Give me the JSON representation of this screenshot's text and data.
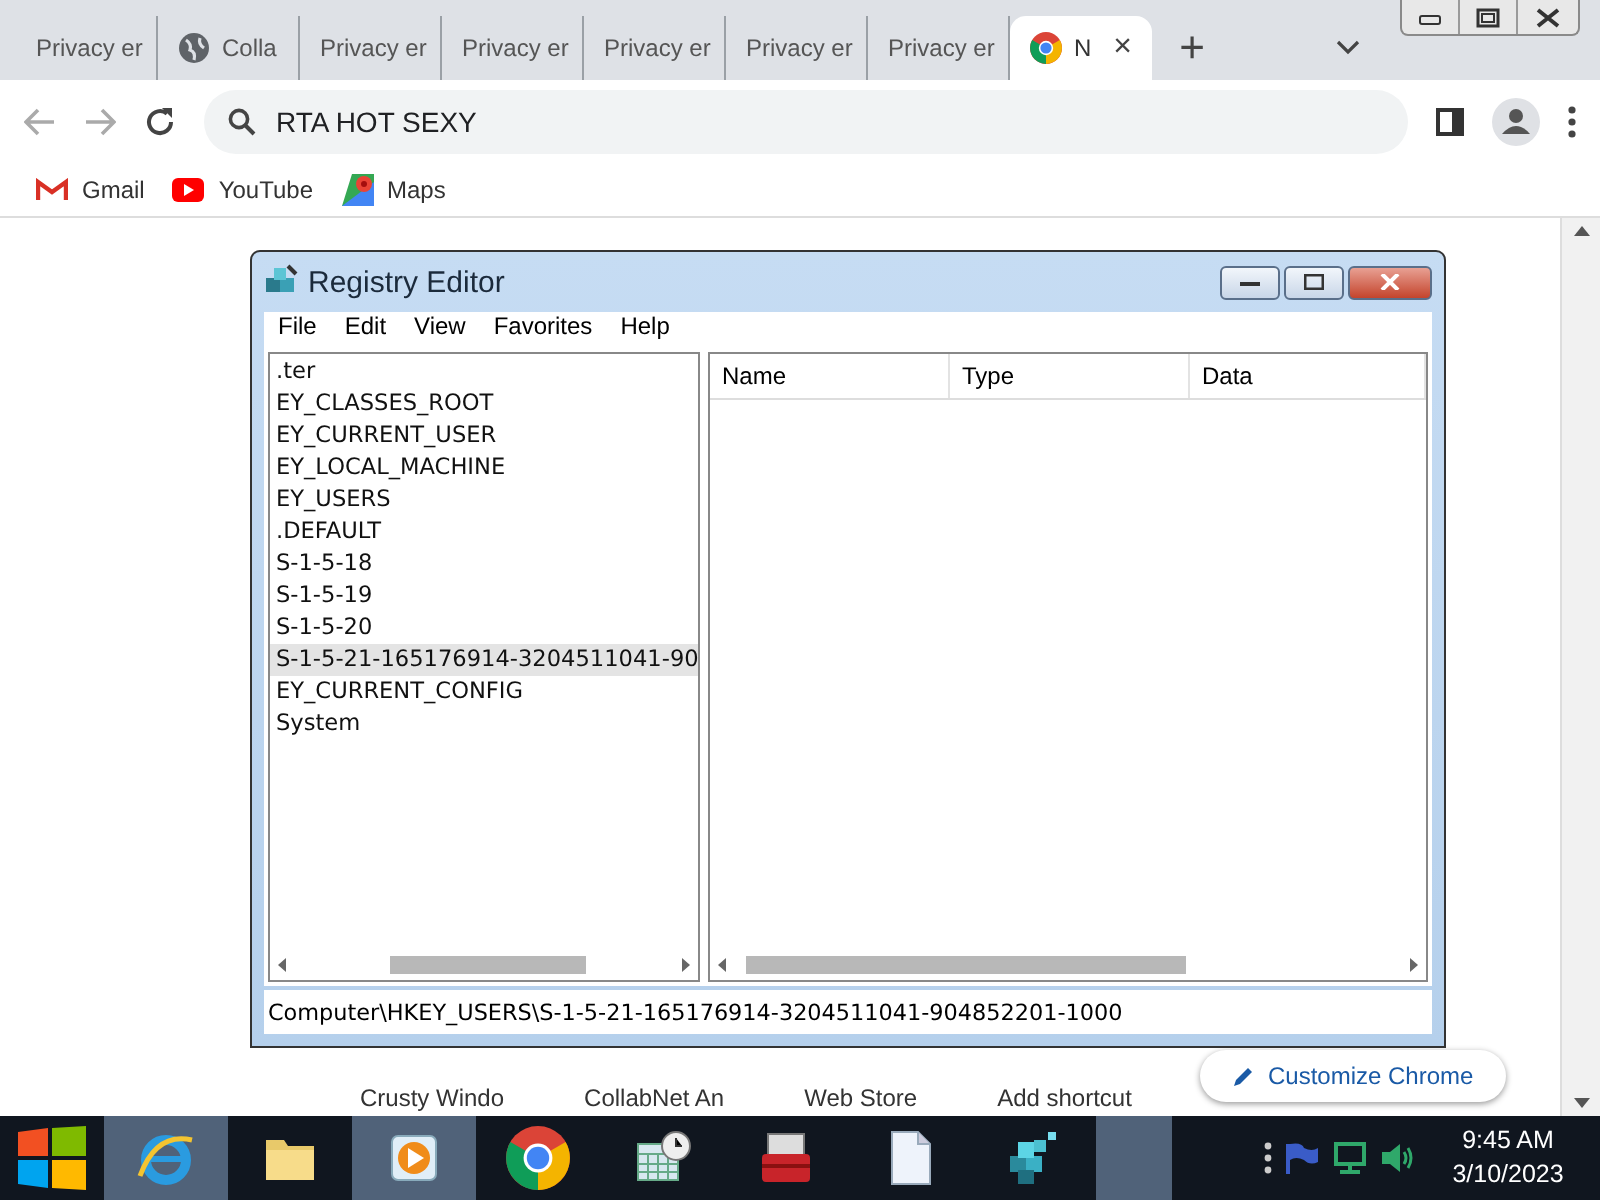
{
  "browser": {
    "tabs": [
      {
        "kind": "page",
        "label": "Privacy er",
        "selected": false
      },
      {
        "kind": "globe",
        "label": "Colla",
        "selected": false
      },
      {
        "kind": "page",
        "label": "Privacy er",
        "selected": false
      },
      {
        "kind": "page",
        "label": "Privacy er",
        "selected": false
      },
      {
        "kind": "page",
        "label": "Privacy er",
        "selected": false
      },
      {
        "kind": "page",
        "label": "Privacy er",
        "selected": false
      },
      {
        "kind": "page",
        "label": "Privacy er",
        "selected": false
      },
      {
        "kind": "chrome",
        "label": "N",
        "selected": true,
        "close": "×"
      }
    ],
    "new_tab": "+",
    "address": {
      "value": "RTA HOT SEXY"
    },
    "bookmarks": [
      {
        "kind": "gmail",
        "label": "Gmail"
      },
      {
        "kind": "youtube",
        "label": "YouTube"
      },
      {
        "kind": "maps",
        "label": "Maps"
      }
    ],
    "shortcuts": [
      "Crusty Windo",
      "CollabNet An",
      "Web Store",
      "Add shortcut"
    ],
    "customize_button": "Customize Chrome"
  },
  "registry_editor": {
    "title": "Registry Editor",
    "menu": [
      "File",
      "Edit",
      "View",
      "Favorites",
      "Help"
    ],
    "tree": [
      {
        "label": ".ter",
        "selected": false,
        "children": [
          {
            "label": "EY_CLASSES_ROOT",
            "selected": false
          },
          {
            "label": "EY_CURRENT_USER",
            "selected": false
          },
          {
            "label": "EY_LOCAL_MACHINE",
            "selected": false
          },
          {
            "label": "EY_USERS",
            "selected": false,
            "children": [
              {
                "label": ".DEFAULT",
                "selected": false
              },
              {
                "label": "S-1-5-18",
                "selected": false
              },
              {
                "label": "S-1-5-19",
                "selected": false
              },
              {
                "label": "S-1-5-20",
                "selected": false
              },
              {
                "label": "S-1-5-21-165176914-3204511041-90",
                "selected": true
              }
            ]
          },
          {
            "label": "EY_CURRENT_CONFIG",
            "selected": false,
            "children": [
              {
                "label": "System",
                "selected": false
              }
            ]
          }
        ]
      }
    ],
    "columns": [
      "Name",
      "Type",
      "Data"
    ],
    "status_bar": "Computer\\HKEY_USERS\\S-1-5-21-165176914-3204511041-904852201-1000"
  },
  "taskbar": {
    "items": [
      {
        "kind": "ie",
        "highlighted": true
      },
      {
        "kind": "folder",
        "highlighted": false
      },
      {
        "kind": "media",
        "highlighted": true
      },
      {
        "kind": "chrome",
        "highlighted": false
      },
      {
        "kind": "calendar",
        "highlighted": false
      },
      {
        "kind": "toolbox",
        "highlighted": false
      },
      {
        "kind": "document",
        "highlighted": false
      },
      {
        "kind": "registry",
        "highlighted": false
      },
      {
        "kind": "blank",
        "highlighted": true
      }
    ],
    "time": "9:45 AM",
    "date": "3/10/2023"
  }
}
